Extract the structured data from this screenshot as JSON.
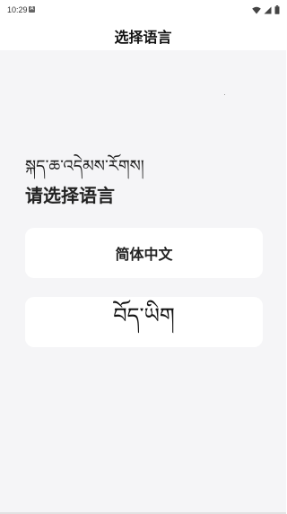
{
  "status_bar": {
    "time": "10:29",
    "notification_icon": "app-notification-icon",
    "icons": [
      "wifi-icon",
      "cellular-signal-icon",
      "battery-icon"
    ]
  },
  "app_bar": {
    "title": "选择语言"
  },
  "prompt": {
    "tibetan": "སྐད་ཆ་འདེམས་རོགས།",
    "chinese": "请选择语言"
  },
  "languages": [
    {
      "label": "简体中文"
    },
    {
      "label": "བོད་ཡིག"
    }
  ],
  "colors": {
    "background": "#f5f5f7",
    "card": "#ffffff",
    "text": "#222222"
  }
}
